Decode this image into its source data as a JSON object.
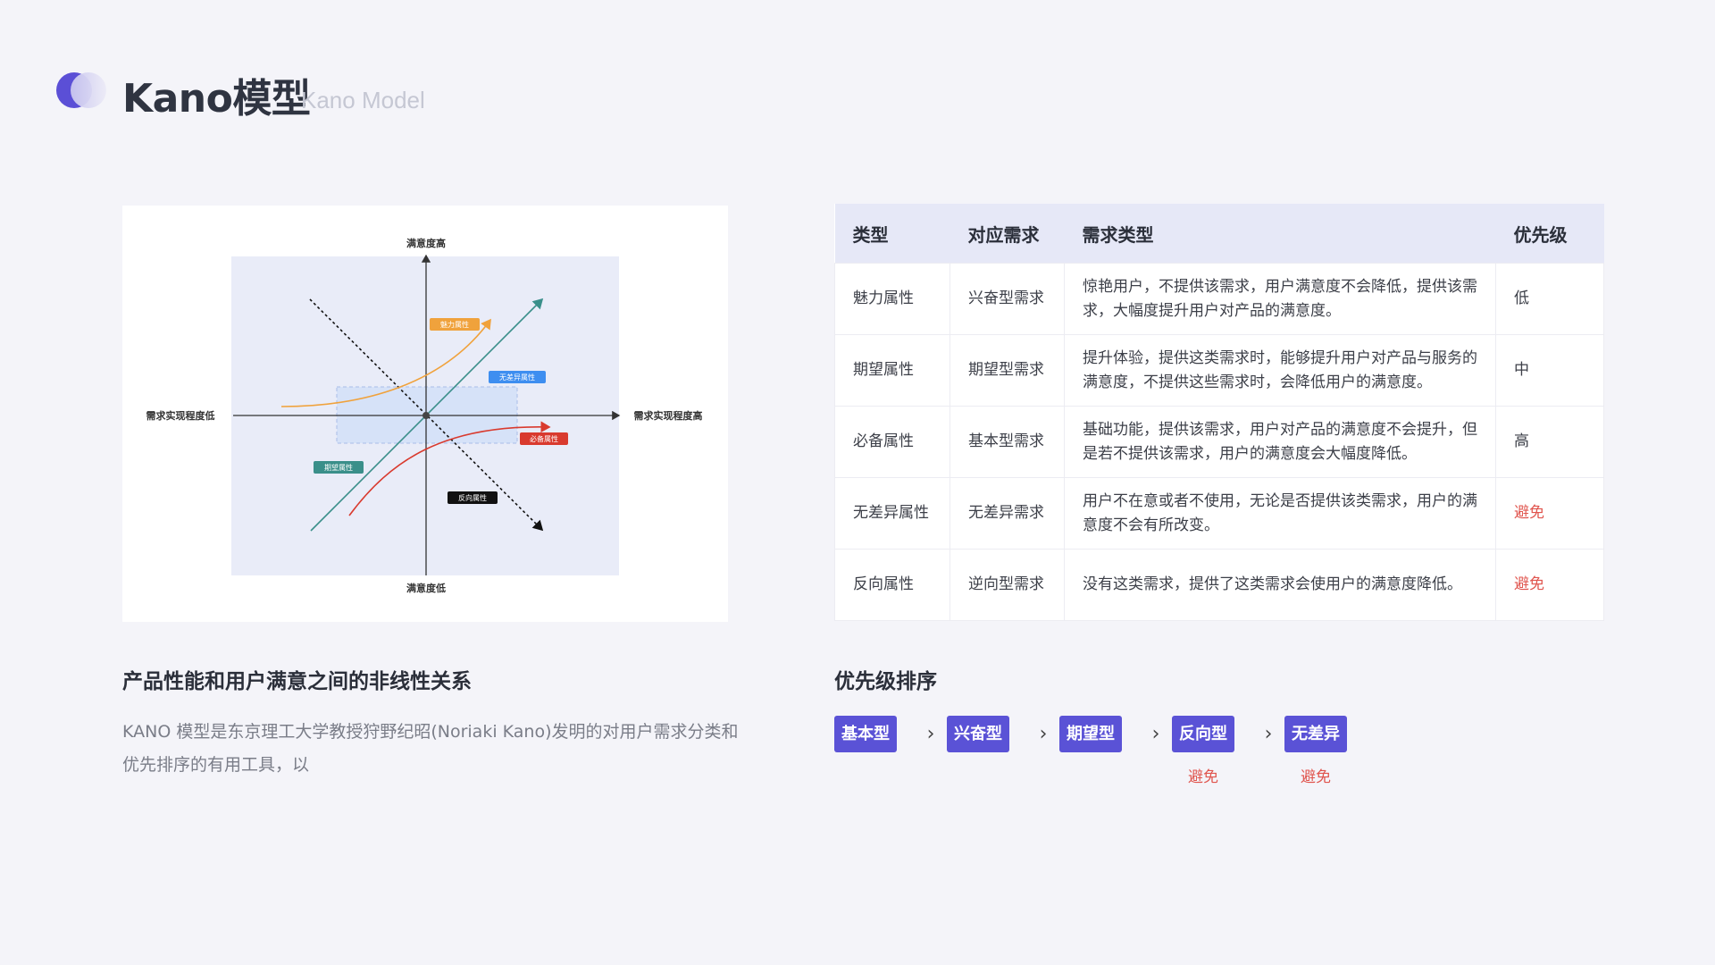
{
  "header": {
    "title": "Kano模型",
    "subtitle": "Kano Model"
  },
  "diagram": {
    "labels": {
      "top": "满意度高",
      "bottom": "满意度低",
      "left": "需求实现程度低",
      "right": "需求实现程度高"
    },
    "tags": {
      "charm": "魅力属性",
      "indifferent": "无差异属性",
      "must": "必备属性",
      "expected": "期望属性",
      "reverse": "反向属性"
    },
    "colors": {
      "charm": "#f0a23c",
      "indifferent": "#3e8ef0",
      "must": "#d93a2e",
      "expected": "#3a8f8a",
      "reverse": "#111111",
      "zone": "#e9ecf8",
      "indifferent_zone": "#d6e2f8"
    }
  },
  "left_section": {
    "heading": "产品性能和用户满意之间的非线性关系",
    "description": "KANO 模型是东京理工大学教授狩野纪昭(Noriaki Kano)发明的对用户需求分类和优先排序的有用工具，以"
  },
  "table": {
    "headers": [
      "类型",
      "对应需求",
      "需求类型",
      "优先级"
    ],
    "rows": [
      {
        "type": "魅力属性",
        "need": "兴奋型需求",
        "desc": "惊艳用户，不提供该需求，用户满意度不会降低，提供该需求，大幅度提升用户对产品的满意度。",
        "priority": "低",
        "avoid": false
      },
      {
        "type": "期望属性",
        "need": "期望型需求",
        "desc": "提升体验，提供这类需求时，能够提升用户对产品与服务的满意度，不提供这些需求时，会降低用户的满意度。",
        "priority": "中",
        "avoid": false
      },
      {
        "type": "必备属性",
        "need": "基本型需求",
        "desc": "基础功能，提供该需求，用户对产品的满意度不会提升，但是若不提供该需求，用户的满意度会大幅度降低。",
        "priority": "高",
        "avoid": false
      },
      {
        "type": "无差异属性",
        "need": "无差异需求",
        "desc": "用户不在意或者不使用，无论是否提供该类需求，用户的满意度不会有所改变。",
        "priority": "避免",
        "avoid": true
      },
      {
        "type": "反向属性",
        "need": "逆向型需求",
        "desc": "没有这类需求，提供了这类需求会使用户的满意度降低。",
        "priority": "避免",
        "avoid": true
      }
    ]
  },
  "priority": {
    "heading": "优先级排序",
    "items": [
      {
        "label": "基本型",
        "note": ""
      },
      {
        "label": "兴奋型",
        "note": ""
      },
      {
        "label": "期望型",
        "note": ""
      },
      {
        "label": "反向型",
        "note": "避免"
      },
      {
        "label": "无差异",
        "note": "避免"
      }
    ],
    "arrow": "›",
    "accent": "#5a52d6",
    "note_color": "#e0554e"
  }
}
